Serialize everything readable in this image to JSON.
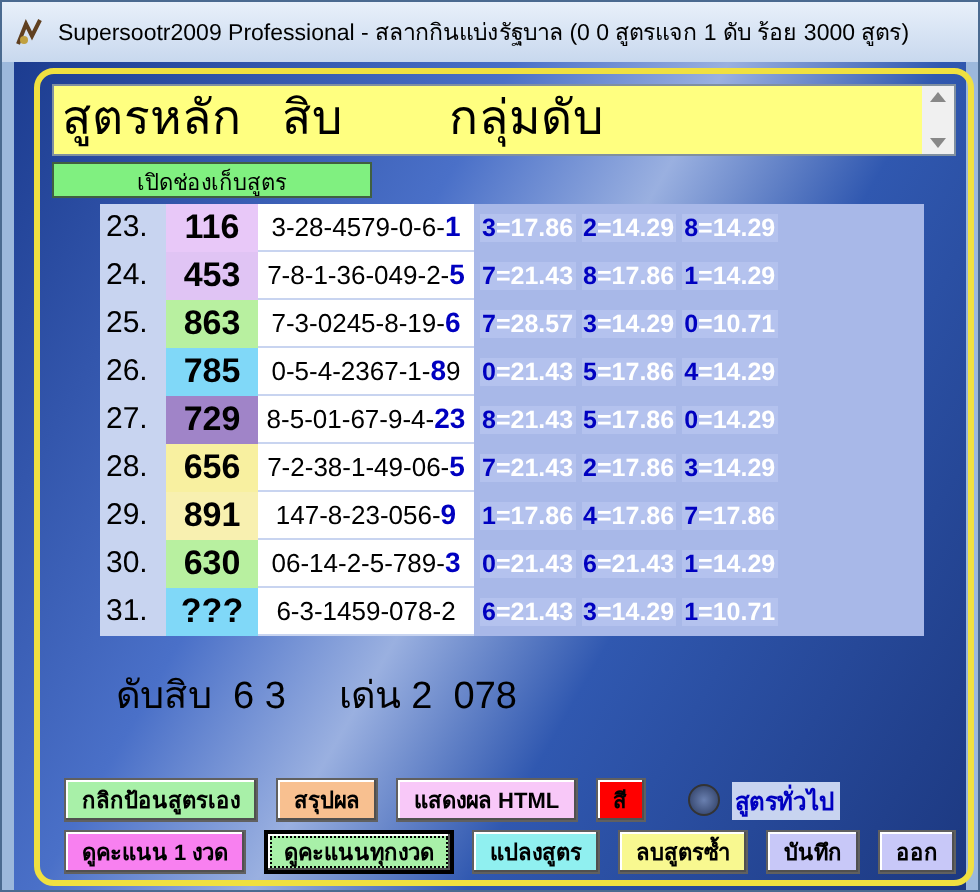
{
  "window": {
    "title": "Supersootr2009 Professional - สลากกินแบ่งรัฐบาล (0 0 สูตรแจก 1 ดับ ร้อย 3000 สูตร)"
  },
  "header": {
    "text": "สูตรหลัก   สิบ        กลุ่มดับ"
  },
  "open_button": {
    "label": "เปิดช่องเก็บสูตร"
  },
  "rows": [
    {
      "index": "23.",
      "number": "116",
      "color": "#e8c8f8",
      "seq_head": "3-28-4579-0-6-",
      "seq_blue": "1",
      "seq_tail": "",
      "stats": [
        {
          "digit": "3",
          "value": "=17.86"
        },
        {
          "digit": "2",
          "value": "=14.29"
        },
        {
          "digit": "8",
          "value": "=14.29"
        }
      ]
    },
    {
      "index": "24.",
      "number": "453",
      "color": "#e0c4f4",
      "seq_head": "7-8-1-36-049-2-",
      "seq_blue": "5",
      "seq_tail": "",
      "stats": [
        {
          "digit": "7",
          "value": "=21.43"
        },
        {
          "digit": "8",
          "value": "=17.86"
        },
        {
          "digit": "1",
          "value": "=14.29"
        }
      ]
    },
    {
      "index": "25.",
      "number": "863",
      "color": "#b8f0a0",
      "seq_head": "7-3-0245-8-19-",
      "seq_blue": "6",
      "seq_tail": "",
      "stats": [
        {
          "digit": "7",
          "value": "=28.57"
        },
        {
          "digit": "3",
          "value": "=14.29"
        },
        {
          "digit": "0",
          "value": "=10.71"
        }
      ]
    },
    {
      "index": "26.",
      "number": "785",
      "color": "#80d8f8",
      "seq_head": "0-5-4-2367-1-",
      "seq_blue": "8",
      "seq_tail": "9",
      "stats": [
        {
          "digit": "0",
          "value": "=21.43"
        },
        {
          "digit": "5",
          "value": "=17.86"
        },
        {
          "digit": "4",
          "value": "=14.29"
        }
      ]
    },
    {
      "index": "27.",
      "number": "729",
      "color": "#a084c8",
      "seq_head": "8-5-01-67-9-4-",
      "seq_blue": "23",
      "seq_tail": "",
      "stats": [
        {
          "digit": "8",
          "value": "=21.43"
        },
        {
          "digit": "5",
          "value": "=17.86"
        },
        {
          "digit": "0",
          "value": "=14.29"
        }
      ]
    },
    {
      "index": "28.",
      "number": "656",
      "color": "#f8f0a0",
      "seq_head": "7-2-38-1-49-06-",
      "seq_blue": "5",
      "seq_tail": "",
      "stats": [
        {
          "digit": "7",
          "value": "=21.43"
        },
        {
          "digit": "2",
          "value": "=17.86"
        },
        {
          "digit": "3",
          "value": "=14.29"
        }
      ]
    },
    {
      "index": "29.",
      "number": "891",
      "color": "#f8f0b0",
      "seq_head": "147-8-23-056-",
      "seq_blue": "9",
      "seq_tail": "",
      "stats": [
        {
          "digit": "1",
          "value": "=17.86"
        },
        {
          "digit": "4",
          "value": "=17.86"
        },
        {
          "digit": "7",
          "value": "=17.86"
        }
      ]
    },
    {
      "index": "30.",
      "number": "630",
      "color": "#b8f0a0",
      "seq_head": "06-14-2-5-789-",
      "seq_blue": "3",
      "seq_tail": "",
      "stats": [
        {
          "digit": "0",
          "value": "=21.43"
        },
        {
          "digit": "6",
          "value": "=21.43"
        },
        {
          "digit": "1",
          "value": "=14.29"
        }
      ]
    },
    {
      "index": "31.",
      "number": "???",
      "color": "#80d8f8",
      "seq_head": "6-3-1459-078-2",
      "seq_blue": "",
      "seq_tail": "",
      "stats": [
        {
          "digit": "6",
          "value": "=21.43"
        },
        {
          "digit": "3",
          "value": "=14.29"
        },
        {
          "digit": "1",
          "value": "=10.71"
        }
      ]
    }
  ],
  "summary": "ดับสิบ  6 3     เด่น 2  078",
  "buttons_row1": [
    {
      "kind": "button",
      "label": "กลิกป้อนสูตรเอง",
      "color": "#a8f0a8",
      "selected": false
    },
    {
      "kind": "button",
      "label": "สรุปผล",
      "color": "#f8c090",
      "selected": false
    },
    {
      "kind": "button",
      "label": "แสดงผล HTML",
      "color": "#f8c8f8",
      "selected": false
    },
    {
      "kind": "button",
      "label": "สี",
      "color": "#ff0000",
      "selected": false
    },
    {
      "kind": "radio",
      "label": "สูตรทั่วไป",
      "checked": false
    }
  ],
  "buttons_row2": [
    {
      "kind": "button",
      "label": "ดูคะแนน 1 งวด",
      "color": "#f880f0",
      "selected": false
    },
    {
      "kind": "button",
      "label": "ดูคะแนนทุกงวด",
      "color": "#a8f0a8",
      "selected": true
    },
    {
      "kind": "button",
      "label": "แปลงสูตร",
      "color": "#90f0f0",
      "selected": false
    },
    {
      "kind": "button",
      "label": "ลบสูตรซ้ำ",
      "color": "#f8f890",
      "selected": false
    },
    {
      "kind": "button",
      "label": "บันทึก",
      "color": "#c8c8f8",
      "selected": false
    },
    {
      "kind": "button",
      "label": "ออก",
      "color": "#c8c8f8",
      "selected": false
    }
  ]
}
